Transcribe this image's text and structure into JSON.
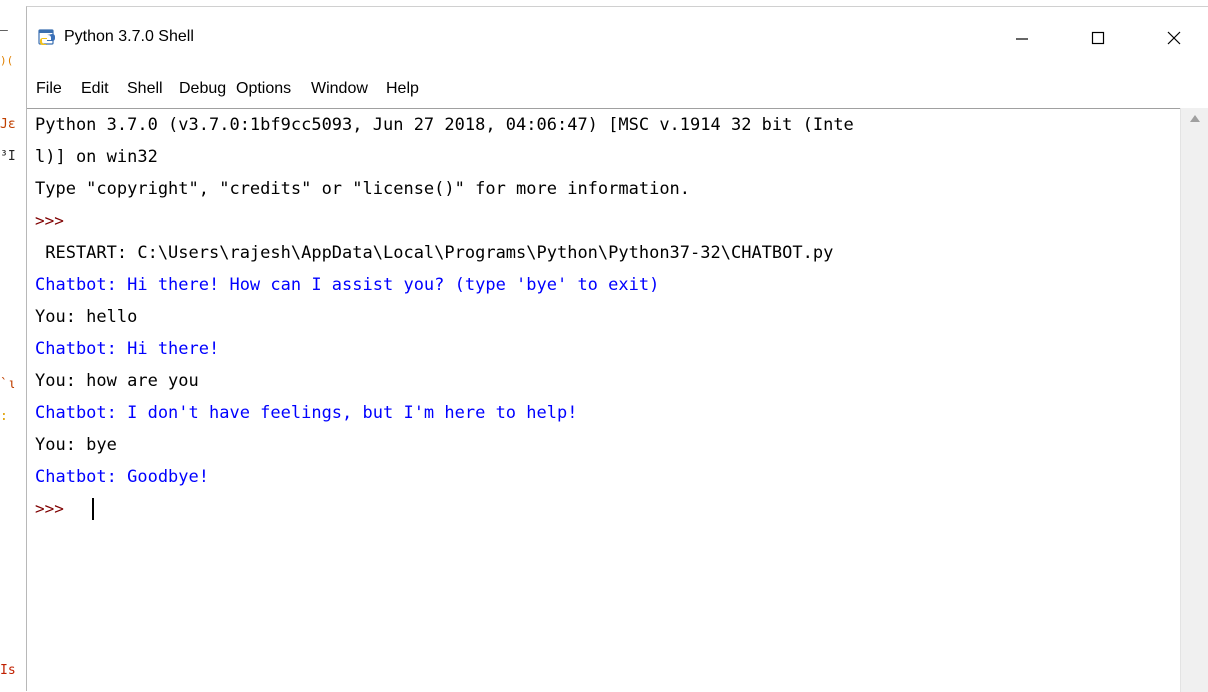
{
  "window": {
    "title": "Python 3.7.0 Shell",
    "controls": {
      "minimize": "—",
      "maximize": "☐",
      "close": "✕"
    }
  },
  "menu": [
    {
      "label": "File"
    },
    {
      "label": "Edit"
    },
    {
      "label": "Shell"
    },
    {
      "label": "Debug"
    },
    {
      "label": "Options"
    },
    {
      "label": "Window"
    },
    {
      "label": "Help"
    }
  ],
  "shell": {
    "header_line_1": "Python 3.7.0 (v3.7.0:1bf9cc5093, Jun 27 2018, 04:06:47) [MSC v.1914 32 bit (Inte",
    "header_line_2": "l)] on win32",
    "info_line": "Type \"copyright\", \"credits\" or \"license()\" for more information.",
    "prompt_1": ">>>",
    "restart_line": " RESTART: C:\\Users\\rajesh\\AppData\\Local\\Programs\\Python\\Python37-32\\CHATBOT.py",
    "chatbot_1": "Chatbot: Hi there! How can I assist you? (type 'bye' to exit)",
    "you_1": "You: hello",
    "chatbot_2": "Chatbot: Hi there!",
    "you_2": "You: how are you",
    "chatbot_3": "Chatbot: I don't have feelings, but I'm here to help!",
    "you_3": "You: bye",
    "chatbot_4": "Chatbot: Goodbye!",
    "prompt_2": ">>>"
  },
  "backdrop_fragments": [
    "— ",
    ")(",
    "Jε",
    "³I",
    "`ι",
    ":",
    "Is"
  ],
  "colors": {
    "output_blue": "#0000ff",
    "prompt_red": "#7f0000",
    "text_black": "#000000"
  },
  "icons": {
    "app": "python-idle-icon",
    "scroll_up": "scroll-up-arrow-icon"
  }
}
